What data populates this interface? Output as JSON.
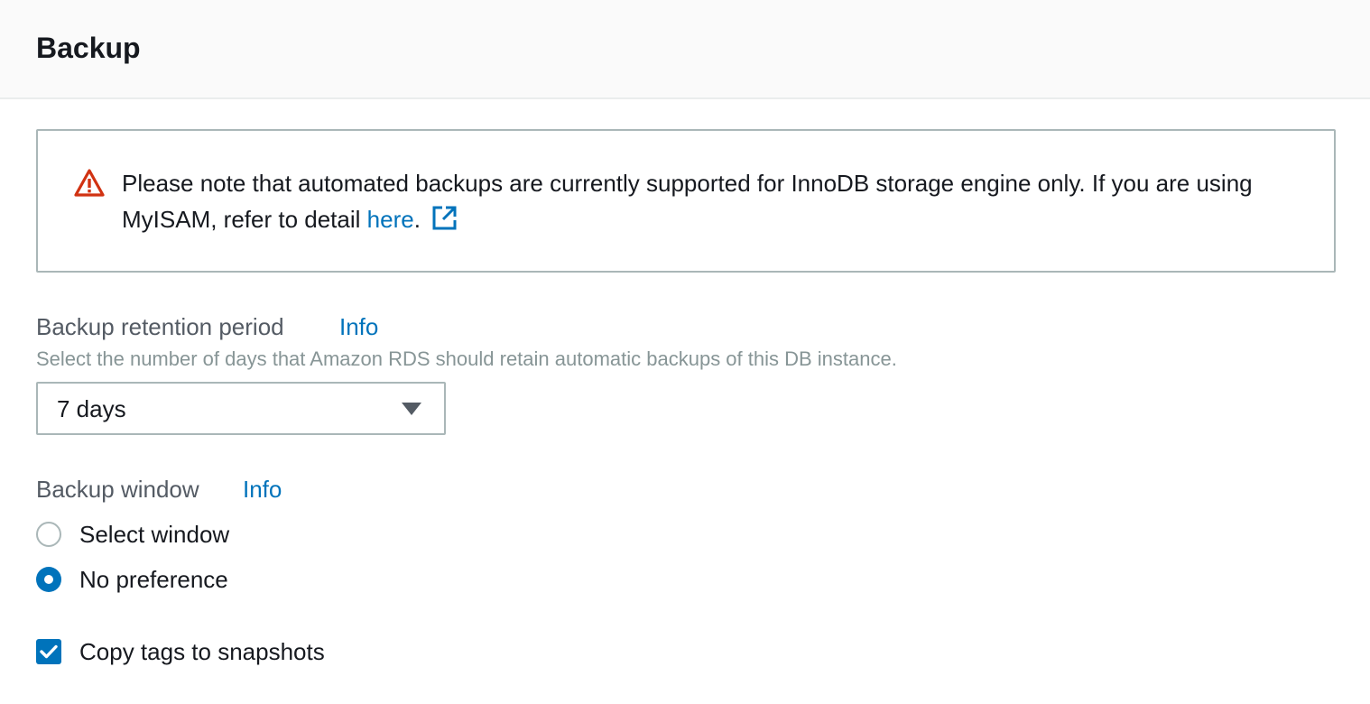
{
  "section": {
    "title": "Backup"
  },
  "alert": {
    "icon": "warning-icon",
    "color": "#d13212",
    "text_before": "Please note that automated backups are currently supported for InnoDB storage engine only. If you are using MyISAM, refer to detail ",
    "link_label": "here",
    "text_after": ".",
    "external_icon": "external-link-icon"
  },
  "retention": {
    "label": "Backup retention period",
    "info_label": "Info",
    "description": "Select the number of days that Amazon RDS should retain automatic backups of this DB instance.",
    "selected_value": "7 days"
  },
  "window": {
    "label": "Backup window",
    "info_label": "Info",
    "options": [
      {
        "label": "Select window",
        "selected": false
      },
      {
        "label": "No preference",
        "selected": true
      }
    ]
  },
  "copy_tags": {
    "label": "Copy tags to snapshots",
    "checked": true
  },
  "colors": {
    "link": "#0073bb",
    "accent": "#0073bb",
    "warning": "#d13212"
  }
}
